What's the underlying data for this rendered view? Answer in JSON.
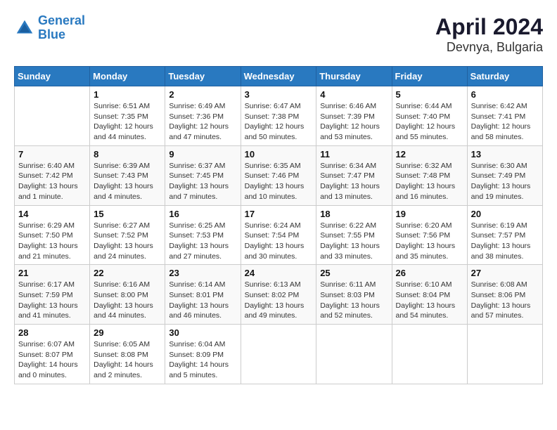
{
  "header": {
    "title": "April 2024",
    "subtitle": "Devnya, Bulgaria",
    "logo_line1": "General",
    "logo_line2": "Blue"
  },
  "columns": [
    "Sunday",
    "Monday",
    "Tuesday",
    "Wednesday",
    "Thursday",
    "Friday",
    "Saturday"
  ],
  "weeks": [
    [
      {
        "day": "",
        "info": ""
      },
      {
        "day": "1",
        "info": "Sunrise: 6:51 AM\nSunset: 7:35 PM\nDaylight: 12 hours\nand 44 minutes."
      },
      {
        "day": "2",
        "info": "Sunrise: 6:49 AM\nSunset: 7:36 PM\nDaylight: 12 hours\nand 47 minutes."
      },
      {
        "day": "3",
        "info": "Sunrise: 6:47 AM\nSunset: 7:38 PM\nDaylight: 12 hours\nand 50 minutes."
      },
      {
        "day": "4",
        "info": "Sunrise: 6:46 AM\nSunset: 7:39 PM\nDaylight: 12 hours\nand 53 minutes."
      },
      {
        "day": "5",
        "info": "Sunrise: 6:44 AM\nSunset: 7:40 PM\nDaylight: 12 hours\nand 55 minutes."
      },
      {
        "day": "6",
        "info": "Sunrise: 6:42 AM\nSunset: 7:41 PM\nDaylight: 12 hours\nand 58 minutes."
      }
    ],
    [
      {
        "day": "7",
        "info": "Sunrise: 6:40 AM\nSunset: 7:42 PM\nDaylight: 13 hours\nand 1 minute."
      },
      {
        "day": "8",
        "info": "Sunrise: 6:39 AM\nSunset: 7:43 PM\nDaylight: 13 hours\nand 4 minutes."
      },
      {
        "day": "9",
        "info": "Sunrise: 6:37 AM\nSunset: 7:45 PM\nDaylight: 13 hours\nand 7 minutes."
      },
      {
        "day": "10",
        "info": "Sunrise: 6:35 AM\nSunset: 7:46 PM\nDaylight: 13 hours\nand 10 minutes."
      },
      {
        "day": "11",
        "info": "Sunrise: 6:34 AM\nSunset: 7:47 PM\nDaylight: 13 hours\nand 13 minutes."
      },
      {
        "day": "12",
        "info": "Sunrise: 6:32 AM\nSunset: 7:48 PM\nDaylight: 13 hours\nand 16 minutes."
      },
      {
        "day": "13",
        "info": "Sunrise: 6:30 AM\nSunset: 7:49 PM\nDaylight: 13 hours\nand 19 minutes."
      }
    ],
    [
      {
        "day": "14",
        "info": "Sunrise: 6:29 AM\nSunset: 7:50 PM\nDaylight: 13 hours\nand 21 minutes."
      },
      {
        "day": "15",
        "info": "Sunrise: 6:27 AM\nSunset: 7:52 PM\nDaylight: 13 hours\nand 24 minutes."
      },
      {
        "day": "16",
        "info": "Sunrise: 6:25 AM\nSunset: 7:53 PM\nDaylight: 13 hours\nand 27 minutes."
      },
      {
        "day": "17",
        "info": "Sunrise: 6:24 AM\nSunset: 7:54 PM\nDaylight: 13 hours\nand 30 minutes."
      },
      {
        "day": "18",
        "info": "Sunrise: 6:22 AM\nSunset: 7:55 PM\nDaylight: 13 hours\nand 33 minutes."
      },
      {
        "day": "19",
        "info": "Sunrise: 6:20 AM\nSunset: 7:56 PM\nDaylight: 13 hours\nand 35 minutes."
      },
      {
        "day": "20",
        "info": "Sunrise: 6:19 AM\nSunset: 7:57 PM\nDaylight: 13 hours\nand 38 minutes."
      }
    ],
    [
      {
        "day": "21",
        "info": "Sunrise: 6:17 AM\nSunset: 7:59 PM\nDaylight: 13 hours\nand 41 minutes."
      },
      {
        "day": "22",
        "info": "Sunrise: 6:16 AM\nSunset: 8:00 PM\nDaylight: 13 hours\nand 44 minutes."
      },
      {
        "day": "23",
        "info": "Sunrise: 6:14 AM\nSunset: 8:01 PM\nDaylight: 13 hours\nand 46 minutes."
      },
      {
        "day": "24",
        "info": "Sunrise: 6:13 AM\nSunset: 8:02 PM\nDaylight: 13 hours\nand 49 minutes."
      },
      {
        "day": "25",
        "info": "Sunrise: 6:11 AM\nSunset: 8:03 PM\nDaylight: 13 hours\nand 52 minutes."
      },
      {
        "day": "26",
        "info": "Sunrise: 6:10 AM\nSunset: 8:04 PM\nDaylight: 13 hours\nand 54 minutes."
      },
      {
        "day": "27",
        "info": "Sunrise: 6:08 AM\nSunset: 8:06 PM\nDaylight: 13 hours\nand 57 minutes."
      }
    ],
    [
      {
        "day": "28",
        "info": "Sunrise: 6:07 AM\nSunset: 8:07 PM\nDaylight: 14 hours\nand 0 minutes."
      },
      {
        "day": "29",
        "info": "Sunrise: 6:05 AM\nSunset: 8:08 PM\nDaylight: 14 hours\nand 2 minutes."
      },
      {
        "day": "30",
        "info": "Sunrise: 6:04 AM\nSunset: 8:09 PM\nDaylight: 14 hours\nand 5 minutes."
      },
      {
        "day": "",
        "info": ""
      },
      {
        "day": "",
        "info": ""
      },
      {
        "day": "",
        "info": ""
      },
      {
        "day": "",
        "info": ""
      }
    ]
  ]
}
